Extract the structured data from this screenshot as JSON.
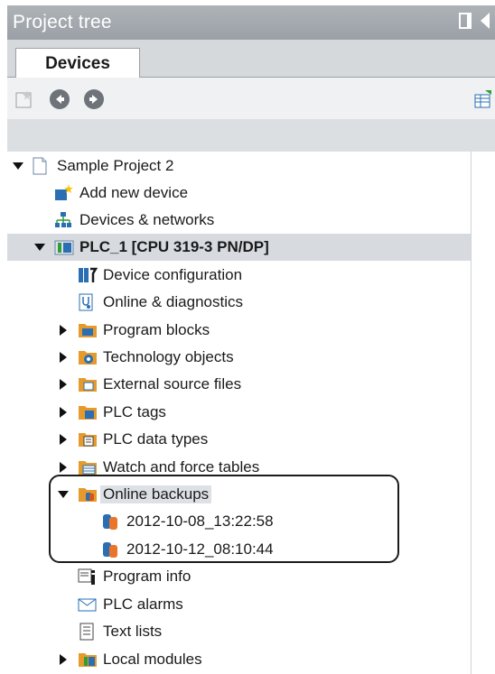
{
  "panel": {
    "title": "Project tree"
  },
  "tabs": [
    {
      "label": "Devices",
      "active": true
    }
  ],
  "toolbar": {
    "icons": [
      "new-folder-icon",
      "back-icon",
      "forward-icon",
      "table-view-icon"
    ]
  },
  "tree": {
    "root": {
      "label": "Sample Project 2",
      "expanded": true
    },
    "items": [
      {
        "label": "Add new device",
        "icon": "add-device-icon"
      },
      {
        "label": "Devices & networks",
        "icon": "network-icon"
      },
      {
        "label": "PLC_1 [CPU 319-3 PN/DP]",
        "icon": "plc-icon",
        "expanded": true,
        "selected": true
      },
      {
        "label": "Device configuration",
        "icon": "device-config-icon"
      },
      {
        "label": "Online & diagnostics",
        "icon": "diagnostics-icon"
      },
      {
        "label": "Program blocks",
        "icon": "folder-blocks-icon",
        "expandable": true
      },
      {
        "label": "Technology objects",
        "icon": "folder-technology-icon",
        "expandable": true
      },
      {
        "label": "External source files",
        "icon": "folder-source-icon",
        "expandable": true
      },
      {
        "label": "PLC tags",
        "icon": "folder-tags-icon",
        "expandable": true
      },
      {
        "label": "PLC data types",
        "icon": "folder-datatypes-icon",
        "expandable": true
      },
      {
        "label": "Watch and force tables",
        "icon": "folder-watch-icon",
        "expandable": true
      },
      {
        "label": "Online backups",
        "icon": "folder-backup-icon",
        "expanded": true
      },
      {
        "label": "2012-10-08_13:22:58",
        "icon": "backup-file-icon"
      },
      {
        "label": "2012-10-12_08:10:44",
        "icon": "backup-file-icon"
      },
      {
        "label": "Program info",
        "icon": "program-info-icon"
      },
      {
        "label": "PLC alarms",
        "icon": "alarms-icon"
      },
      {
        "label": "Text lists",
        "icon": "text-list-icon"
      },
      {
        "label": "Local modules",
        "icon": "folder-modules-icon",
        "expandable": true
      }
    ]
  },
  "colors": {
    "titlebar": "#9aa0a6",
    "selected_row": "#d7dbe0",
    "folder_orange": "#e59a2b",
    "folder_blue": "#2a6fb3"
  }
}
